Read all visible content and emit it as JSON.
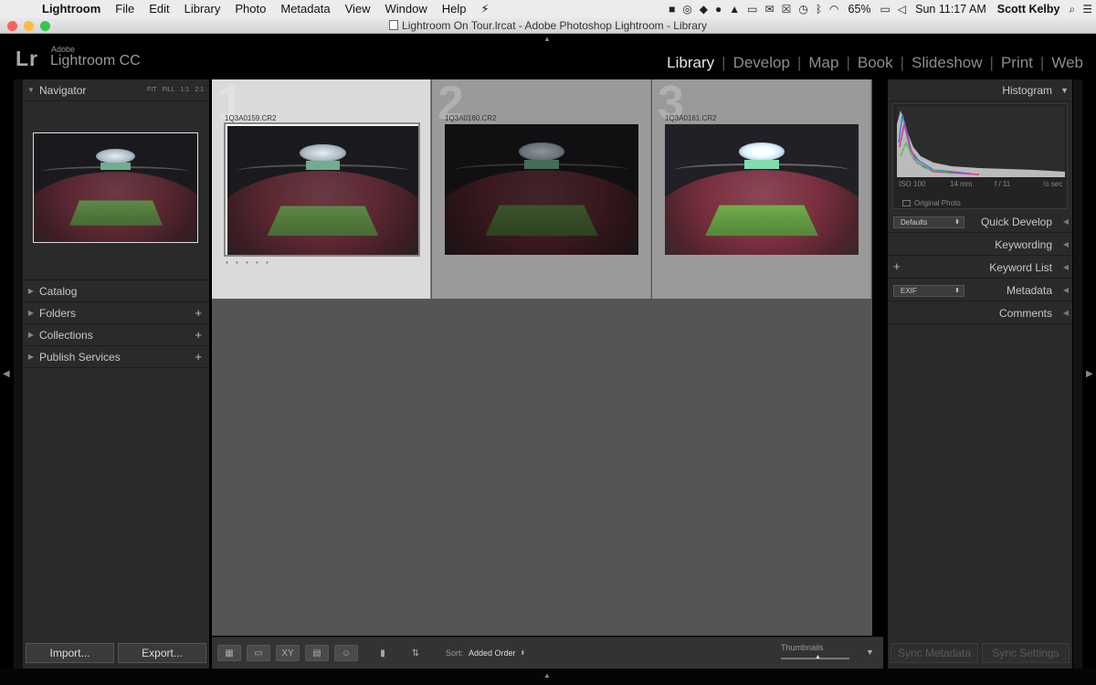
{
  "menubar": {
    "app_name": "Lightroom",
    "menus": [
      "File",
      "Edit",
      "Library",
      "Photo",
      "Metadata",
      "View",
      "Window",
      "Help"
    ],
    "battery": "65%",
    "clock": "Sun 11:17 AM",
    "user": "Scott Kelby"
  },
  "window": {
    "title": "Lightroom On Tour.lrcat - Adobe Photoshop Lightroom - Library"
  },
  "identity": {
    "logo": "Lr",
    "brand_small": "Adobe",
    "brand_big": "Lightroom CC"
  },
  "modules": [
    "Library",
    "Develop",
    "Map",
    "Book",
    "Slideshow",
    "Print",
    "Web"
  ],
  "active_module": "Library",
  "navigator": {
    "title": "Navigator",
    "zoom": [
      "FIT",
      "FILL",
      "1:1",
      "2:1"
    ]
  },
  "left_sections": [
    {
      "label": "Catalog",
      "plus": ""
    },
    {
      "label": "Folders",
      "plus": "+"
    },
    {
      "label": "Collections",
      "plus": "+"
    },
    {
      "label": "Publish Services",
      "plus": "+"
    }
  ],
  "grid": {
    "cells": [
      {
        "num": "1",
        "filename": "1Q3A0159.CR2",
        "dots": "• • • • •"
      },
      {
        "num": "2",
        "filename": "1Q3A0160.CR2",
        "dots": ""
      },
      {
        "num": "3",
        "filename": "1Q3A0161.CR2",
        "dots": ""
      }
    ]
  },
  "toolbar": {
    "sort_label": "Sort:",
    "sort_value": "Added Order",
    "thumb_label": "Thumbnails"
  },
  "histogram": {
    "title": "Histogram",
    "iso": "ISO 100",
    "focal": "14 mm",
    "aperture": "f / 11",
    "shutter": "½ sec",
    "original_photo": "Original Photo"
  },
  "right_sections": {
    "quick_develop": "Quick Develop",
    "preset": "Defaults",
    "keywording": "Keywording",
    "keyword_list": "Keyword List",
    "metadata": "Metadata",
    "metadata_preset": "EXIF",
    "comments": "Comments"
  },
  "buttons": {
    "import": "Import...",
    "export": "Export...",
    "sync_metadata": "Sync Metadata",
    "sync_settings": "Sync Settings"
  },
  "colors": {
    "selected_cell": "#dadada",
    "grid_bg": "#555555",
    "panel_bg": "#2a2a2a"
  }
}
